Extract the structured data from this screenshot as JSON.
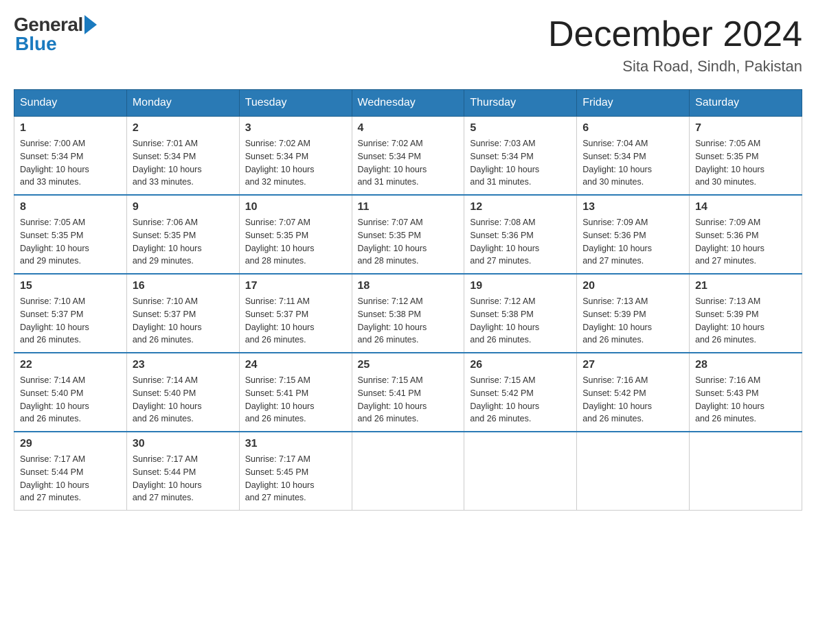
{
  "header": {
    "month_title": "December 2024",
    "location": "Sita Road, Sindh, Pakistan",
    "logo_general": "General",
    "logo_blue": "Blue"
  },
  "days_of_week": [
    "Sunday",
    "Monday",
    "Tuesday",
    "Wednesday",
    "Thursday",
    "Friday",
    "Saturday"
  ],
  "weeks": [
    [
      {
        "day": "1",
        "sunrise": "7:00 AM",
        "sunset": "5:34 PM",
        "daylight": "10 hours and 33 minutes."
      },
      {
        "day": "2",
        "sunrise": "7:01 AM",
        "sunset": "5:34 PM",
        "daylight": "10 hours and 33 minutes."
      },
      {
        "day": "3",
        "sunrise": "7:02 AM",
        "sunset": "5:34 PM",
        "daylight": "10 hours and 32 minutes."
      },
      {
        "day": "4",
        "sunrise": "7:02 AM",
        "sunset": "5:34 PM",
        "daylight": "10 hours and 31 minutes."
      },
      {
        "day": "5",
        "sunrise": "7:03 AM",
        "sunset": "5:34 PM",
        "daylight": "10 hours and 31 minutes."
      },
      {
        "day": "6",
        "sunrise": "7:04 AM",
        "sunset": "5:34 PM",
        "daylight": "10 hours and 30 minutes."
      },
      {
        "day": "7",
        "sunrise": "7:05 AM",
        "sunset": "5:35 PM",
        "daylight": "10 hours and 30 minutes."
      }
    ],
    [
      {
        "day": "8",
        "sunrise": "7:05 AM",
        "sunset": "5:35 PM",
        "daylight": "10 hours and 29 minutes."
      },
      {
        "day": "9",
        "sunrise": "7:06 AM",
        "sunset": "5:35 PM",
        "daylight": "10 hours and 29 minutes."
      },
      {
        "day": "10",
        "sunrise": "7:07 AM",
        "sunset": "5:35 PM",
        "daylight": "10 hours and 28 minutes."
      },
      {
        "day": "11",
        "sunrise": "7:07 AM",
        "sunset": "5:35 PM",
        "daylight": "10 hours and 28 minutes."
      },
      {
        "day": "12",
        "sunrise": "7:08 AM",
        "sunset": "5:36 PM",
        "daylight": "10 hours and 27 minutes."
      },
      {
        "day": "13",
        "sunrise": "7:09 AM",
        "sunset": "5:36 PM",
        "daylight": "10 hours and 27 minutes."
      },
      {
        "day": "14",
        "sunrise": "7:09 AM",
        "sunset": "5:36 PM",
        "daylight": "10 hours and 27 minutes."
      }
    ],
    [
      {
        "day": "15",
        "sunrise": "7:10 AM",
        "sunset": "5:37 PM",
        "daylight": "10 hours and 26 minutes."
      },
      {
        "day": "16",
        "sunrise": "7:10 AM",
        "sunset": "5:37 PM",
        "daylight": "10 hours and 26 minutes."
      },
      {
        "day": "17",
        "sunrise": "7:11 AM",
        "sunset": "5:37 PM",
        "daylight": "10 hours and 26 minutes."
      },
      {
        "day": "18",
        "sunrise": "7:12 AM",
        "sunset": "5:38 PM",
        "daylight": "10 hours and 26 minutes."
      },
      {
        "day": "19",
        "sunrise": "7:12 AM",
        "sunset": "5:38 PM",
        "daylight": "10 hours and 26 minutes."
      },
      {
        "day": "20",
        "sunrise": "7:13 AM",
        "sunset": "5:39 PM",
        "daylight": "10 hours and 26 minutes."
      },
      {
        "day": "21",
        "sunrise": "7:13 AM",
        "sunset": "5:39 PM",
        "daylight": "10 hours and 26 minutes."
      }
    ],
    [
      {
        "day": "22",
        "sunrise": "7:14 AM",
        "sunset": "5:40 PM",
        "daylight": "10 hours and 26 minutes."
      },
      {
        "day": "23",
        "sunrise": "7:14 AM",
        "sunset": "5:40 PM",
        "daylight": "10 hours and 26 minutes."
      },
      {
        "day": "24",
        "sunrise": "7:15 AM",
        "sunset": "5:41 PM",
        "daylight": "10 hours and 26 minutes."
      },
      {
        "day": "25",
        "sunrise": "7:15 AM",
        "sunset": "5:41 PM",
        "daylight": "10 hours and 26 minutes."
      },
      {
        "day": "26",
        "sunrise": "7:15 AM",
        "sunset": "5:42 PM",
        "daylight": "10 hours and 26 minutes."
      },
      {
        "day": "27",
        "sunrise": "7:16 AM",
        "sunset": "5:42 PM",
        "daylight": "10 hours and 26 minutes."
      },
      {
        "day": "28",
        "sunrise": "7:16 AM",
        "sunset": "5:43 PM",
        "daylight": "10 hours and 26 minutes."
      }
    ],
    [
      {
        "day": "29",
        "sunrise": "7:17 AM",
        "sunset": "5:44 PM",
        "daylight": "10 hours and 27 minutes."
      },
      {
        "day": "30",
        "sunrise": "7:17 AM",
        "sunset": "5:44 PM",
        "daylight": "10 hours and 27 minutes."
      },
      {
        "day": "31",
        "sunrise": "7:17 AM",
        "sunset": "5:45 PM",
        "daylight": "10 hours and 27 minutes."
      },
      null,
      null,
      null,
      null
    ]
  ],
  "labels": {
    "sunrise": "Sunrise:",
    "sunset": "Sunset:",
    "daylight": "Daylight:"
  }
}
